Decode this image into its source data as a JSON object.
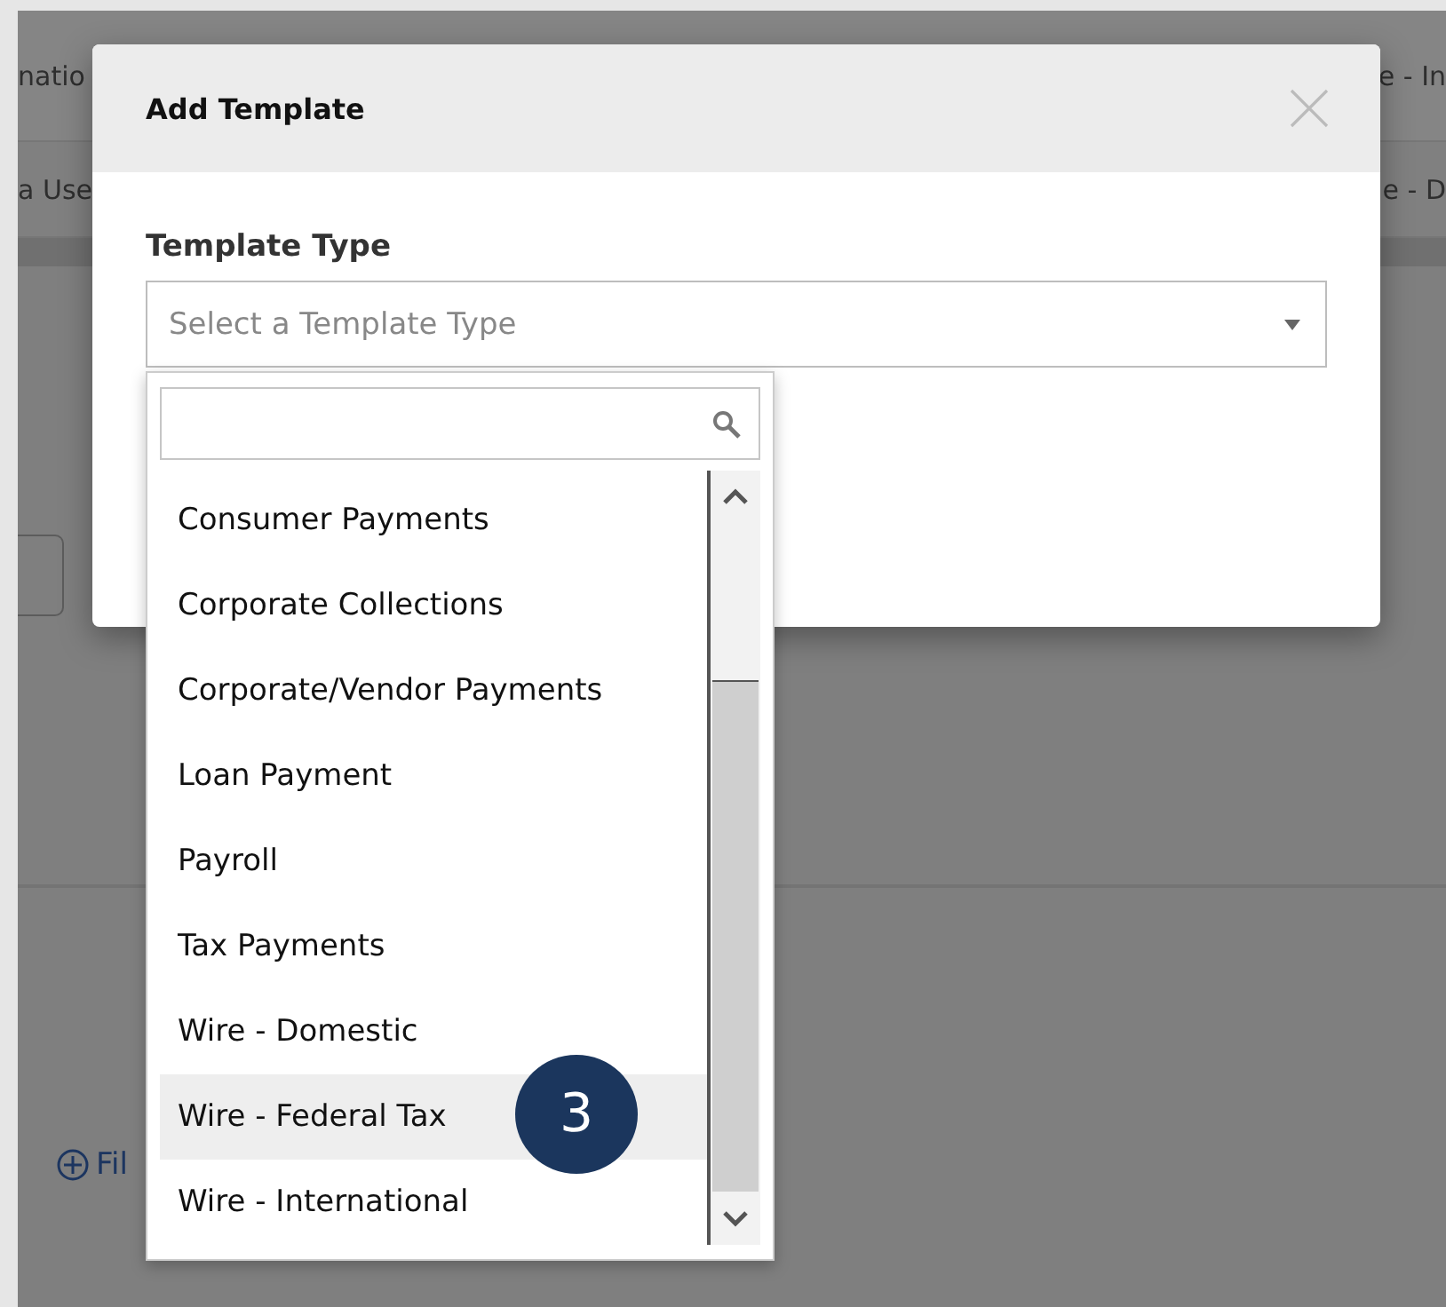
{
  "background": {
    "rows": [
      {
        "left": "natio",
        "right": "e - In"
      },
      {
        "left": "a Use",
        "right": "e - D"
      }
    ],
    "link": "Fil"
  },
  "dialog": {
    "title": "Add Template",
    "field": {
      "label": "Template Type",
      "placeholder": "Select a Template Type"
    },
    "options": [
      {
        "label": "Consumer Payments",
        "selected": false
      },
      {
        "label": "Corporate Collections",
        "selected": false
      },
      {
        "label": "Corporate/Vendor Payments",
        "selected": false
      },
      {
        "label": "Loan Payment",
        "selected": false
      },
      {
        "label": "Payroll",
        "selected": false
      },
      {
        "label": "Tax Payments",
        "selected": false
      },
      {
        "label": "Wire - Domestic",
        "selected": false
      },
      {
        "label": "Wire - Federal Tax",
        "selected": true
      },
      {
        "label": "Wire - International",
        "selected": false
      }
    ]
  },
  "callout": "3"
}
